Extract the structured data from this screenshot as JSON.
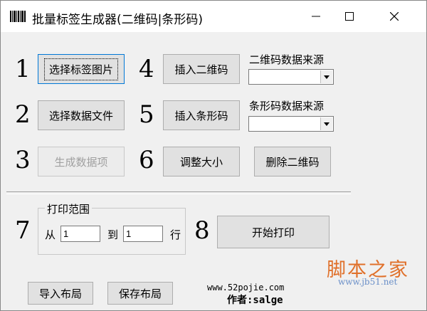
{
  "window": {
    "title": "批量标签生成器(二维码|条形码)",
    "minimize_glyph": "—",
    "maximize_glyph": "☐",
    "close_glyph": "✕"
  },
  "steps": {
    "n1": "1",
    "n2": "2",
    "n3": "3",
    "n4": "4",
    "n5": "5",
    "n6": "6",
    "n7": "7",
    "n8": "8"
  },
  "buttons": {
    "select_label_image": "选择标签图片",
    "select_data_file": "选择数据文件",
    "generate_data_items": "生成数据项",
    "insert_qrcode": "插入二维码",
    "insert_barcode": "插入条形码",
    "resize": "调整大小",
    "delete_qrcode": "删除二维码",
    "start_print": "开始打印",
    "import_layout": "导入布局",
    "save_layout": "保存布局"
  },
  "qrcode_source": {
    "label": "二维码数据来源",
    "value": ""
  },
  "barcode_source": {
    "label": "条形码数据来源",
    "value": ""
  },
  "print_range": {
    "label": "打印范围",
    "from_label": "从",
    "from_value": "1",
    "to_label": "到",
    "to_value": "1",
    "row_label": "行"
  },
  "footer": {
    "website": "www.52pojie.com",
    "author": "作者:salge"
  },
  "watermark": {
    "cn": "脚本之家",
    "url": "www.jb51.net"
  }
}
